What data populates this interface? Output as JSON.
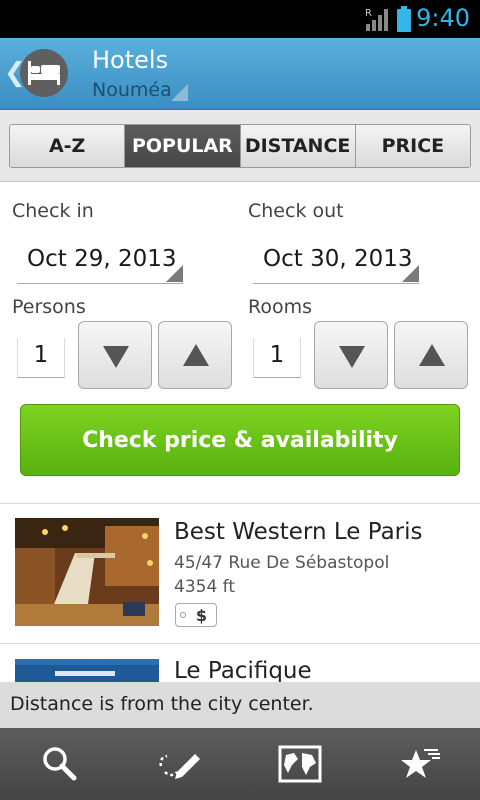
{
  "status_bar": {
    "time": "9:40",
    "signal_label": "R",
    "accent_color": "#33b5e5"
  },
  "action_bar": {
    "title": "Hotels",
    "subtitle": "Nouméa",
    "icon": "bed-icon"
  },
  "sort_tabs": [
    {
      "label": "A-Z",
      "active": false
    },
    {
      "label": "POPULAR",
      "active": true
    },
    {
      "label": "DISTANCE",
      "active": false
    },
    {
      "label": "PRICE",
      "active": false
    }
  ],
  "form": {
    "check_in_label": "Check in",
    "check_in_value": "Oct 29, 2013",
    "check_out_label": "Check out",
    "check_out_value": "Oct 30, 2013",
    "persons_label": "Persons",
    "persons_value": "1",
    "rooms_label": "Rooms",
    "rooms_value": "1",
    "cta_label": "Check price & availability",
    "cta_color": "#6cc417"
  },
  "hotels": [
    {
      "name": "Best Western Le Paris",
      "address": "45/47 Rue De Sébastopol",
      "distance": "4354 ft",
      "price_level": "$"
    },
    {
      "name": "Le Pacifique"
    }
  ],
  "toast": {
    "text": "Distance is from the city center."
  },
  "bottom_bar": {
    "items": [
      "search-icon",
      "edit-route-icon",
      "map-icon",
      "favorites-icon"
    ]
  }
}
